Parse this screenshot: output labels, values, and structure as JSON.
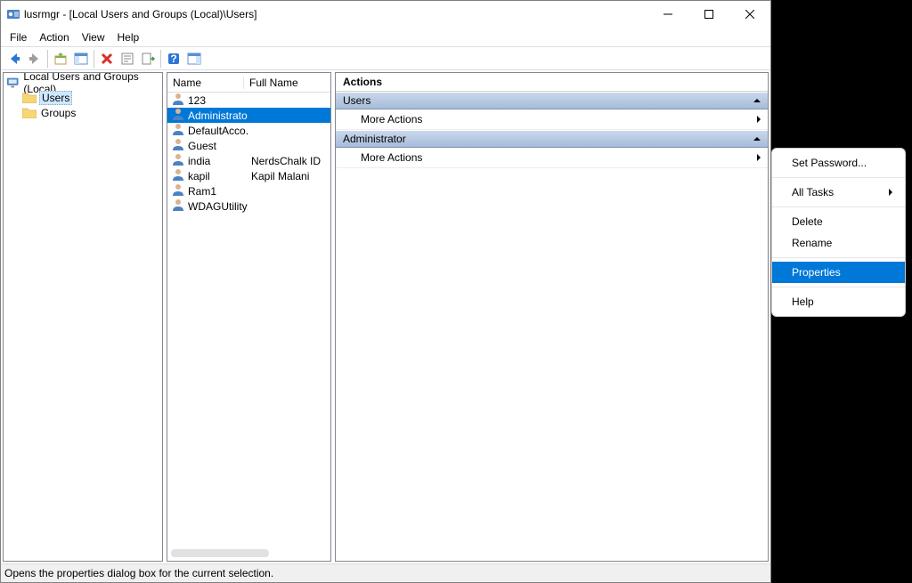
{
  "window_title": "lusrmgr - [Local Users and Groups (Local)\\Users]",
  "menu": {
    "file": "File",
    "action": "Action",
    "view": "View",
    "help": "Help"
  },
  "tree": {
    "root": "Local Users and Groups (Local)",
    "users": "Users",
    "groups": "Groups"
  },
  "list_headers": {
    "name": "Name",
    "fullname": "Full Name"
  },
  "users_list": [
    {
      "name": "123",
      "fullname": ""
    },
    {
      "name": "Administrator",
      "fullname": ""
    },
    {
      "name": "DefaultAcco...",
      "fullname": ""
    },
    {
      "name": "Guest",
      "fullname": ""
    },
    {
      "name": "india",
      "fullname": "NerdsChalk ID"
    },
    {
      "name": "kapil",
      "fullname": "Kapil Malani"
    },
    {
      "name": "Ram1",
      "fullname": ""
    },
    {
      "name": "WDAGUtility...",
      "fullname": ""
    }
  ],
  "actions": {
    "header": "Actions",
    "section_users": "Users",
    "section_admin": "Administrator",
    "more_actions": "More Actions"
  },
  "context_menu": {
    "set_password": "Set Password...",
    "all_tasks": "All Tasks",
    "delete": "Delete",
    "rename": "Rename",
    "properties": "Properties",
    "help": "Help"
  },
  "statusbar": "Opens the properties dialog box for the current selection."
}
